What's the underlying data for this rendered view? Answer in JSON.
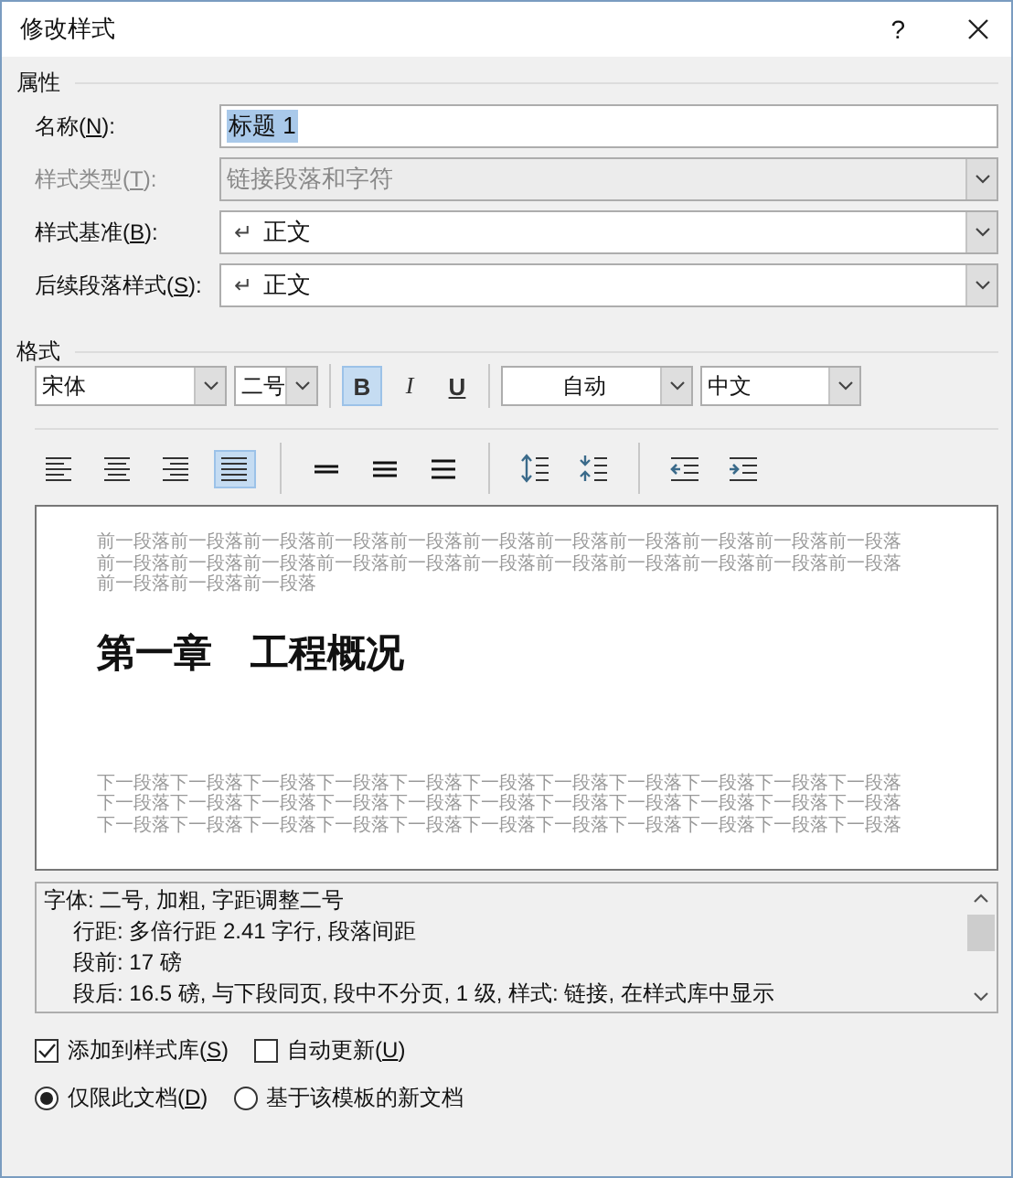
{
  "window": {
    "title": "修改样式",
    "help": "?"
  },
  "properties": {
    "heading": "属性",
    "fields": [
      {
        "kind": "text",
        "label": {
          "before": "名称(",
          "key": "N",
          "after": "):"
        },
        "value": "标题 1",
        "text_selected": true,
        "disabled": false
      },
      {
        "kind": "combo",
        "label": {
          "before": "样式类型(",
          "key": "T",
          "after": "):"
        },
        "value": "链接段落和字符",
        "disabled": true
      },
      {
        "kind": "combo",
        "label": {
          "before": "样式基准(",
          "key": "B",
          "after": "):"
        },
        "mark": "↵",
        "value": "正文",
        "disabled": false
      },
      {
        "kind": "combo",
        "label": {
          "before": "后续段落样式(",
          "key": "S",
          "after": "):"
        },
        "mark": "↵",
        "value": "正文",
        "disabled": false
      }
    ]
  },
  "format": {
    "heading": "格式",
    "font": "宋体",
    "size": "二号",
    "styles": [
      {
        "kind": "bold",
        "label": "B",
        "selected": true
      },
      {
        "kind": "italic",
        "label": "I",
        "selected": false
      },
      {
        "kind": "underline",
        "label": "U",
        "selected": false
      }
    ],
    "font_color": "自动",
    "language": "中文",
    "paragraph_groups": [
      {
        "buttons": [
          {
            "kind": "align-left",
            "selected": false
          },
          {
            "kind": "align-center",
            "selected": false
          },
          {
            "kind": "align-right",
            "selected": false
          },
          {
            "kind": "justify",
            "selected": true
          }
        ]
      },
      {
        "buttons": [
          {
            "kind": "single-spacing",
            "selected": false
          },
          {
            "kind": "one-half-spacing",
            "selected": false
          },
          {
            "kind": "double-spacing",
            "selected": false
          }
        ]
      },
      {
        "buttons": [
          {
            "kind": "increase-spacing",
            "selected": false
          },
          {
            "kind": "decrease-spacing",
            "selected": false
          }
        ]
      },
      {
        "buttons": [
          {
            "kind": "decrease-indent",
            "selected": false
          },
          {
            "kind": "increase-indent",
            "selected": false
          }
        ]
      }
    ]
  },
  "preview": {
    "before_lines": [
      "前一段落前一段落前一段落前一段落前一段落前一段落前一段落前一段落前一段落前一段落前一段落",
      "前一段落前一段落前一段落前一段落前一段落前一段落前一段落前一段落前一段落前一段落前一段落",
      "前一段落前一段落前一段落"
    ],
    "heading": "第一章　工程概况",
    "after_lines": [
      "下一段落下一段落下一段落下一段落下一段落下一段落下一段落下一段落下一段落下一段落下一段落",
      "下一段落下一段落下一段落下一段落下一段落下一段落下一段落下一段落下一段落下一段落下一段落",
      "下一段落下一段落下一段落下一段落下一段落下一段落下一段落下一段落下一段落下一段落下一段落"
    ]
  },
  "description": [
    {
      "text": "字体: 二号, 加粗, 字距调整二号",
      "children": [
        {
          "text": "行距: 多倍行距 2.41 字行, 段落间距"
        },
        {
          "text": "段前: 17 磅"
        },
        {
          "text": "段后: 16.5 磅, 与下段同页, 段中不分页, 1 级, 样式: 链接, 在样式库中显示"
        }
      ]
    }
  ],
  "checkboxes": [
    {
      "label": {
        "before": "添加到样式库(",
        "key": "S",
        "after": ")"
      },
      "checked": true
    },
    {
      "label": {
        "before": "自动更新(",
        "key": "U",
        "after": ")"
      },
      "checked": false
    }
  ],
  "radios": [
    {
      "label": {
        "before": "仅限此文档(",
        "key": "D",
        "after": ")"
      },
      "selected": true
    },
    {
      "label": {
        "before": "基于该模板的新文档"
      },
      "selected": false
    }
  ]
}
